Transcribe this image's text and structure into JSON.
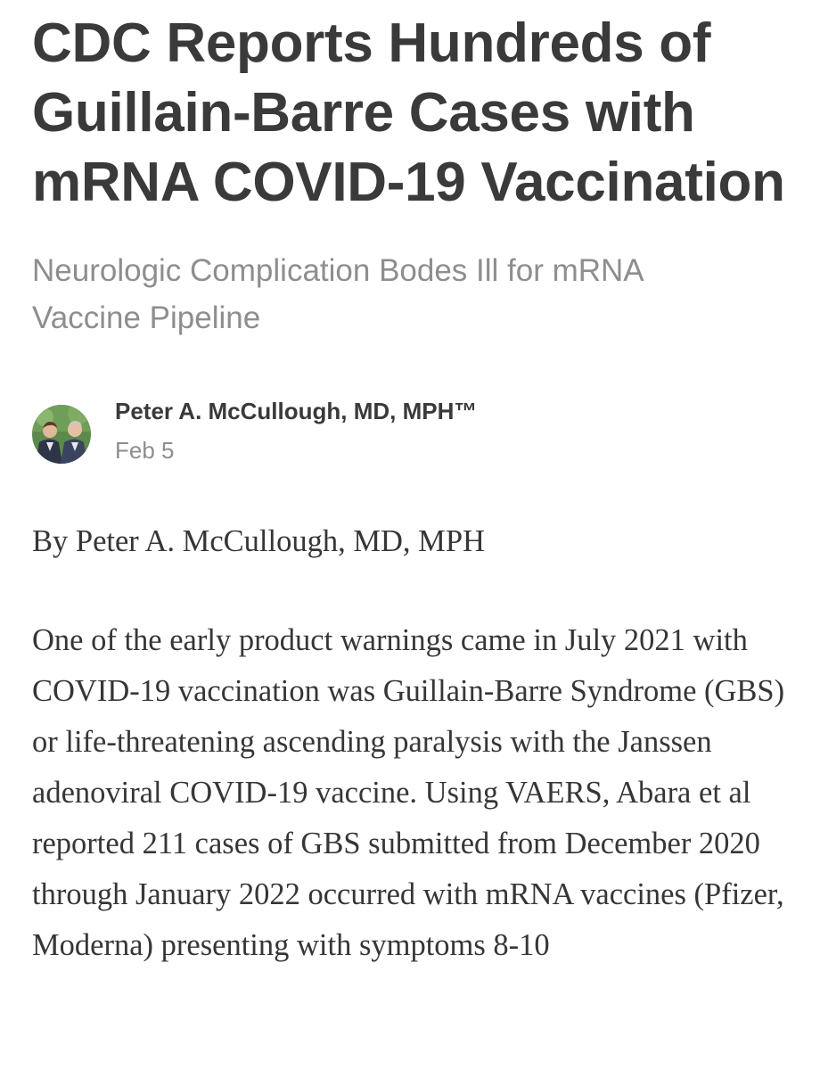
{
  "article": {
    "title": "CDC Reports Hundreds of Guillain-Barre Cases with mRNA COVID-19 Vaccination",
    "subtitle": "Neurologic Complication Bodes Ill for mRNA Vaccine Pipeline",
    "author": {
      "name": "Peter A. McCullough, MD, MPH™",
      "date": "Feb 5"
    },
    "byline": "By Peter A. McCullough, MD, MPH",
    "paragraphs": [
      "One of the early product warnings came in July 2021 with COVID-19 vaccination was Guillain-Barre Syndrome (GBS) or life-threatening ascending paralysis with the Janssen adenoviral COVID-19 vaccine. Using VAERS, Abara et al reported 211 cases of GBS submitted from December 2020 through January 2022 occurred with mRNA vaccines (Pfizer, Moderna) presenting with symptoms 8-10"
    ]
  },
  "colors": {
    "title": "#3a3a3a",
    "subtitle": "#8e8e8e",
    "body": "#363636",
    "background": "#ffffff"
  }
}
